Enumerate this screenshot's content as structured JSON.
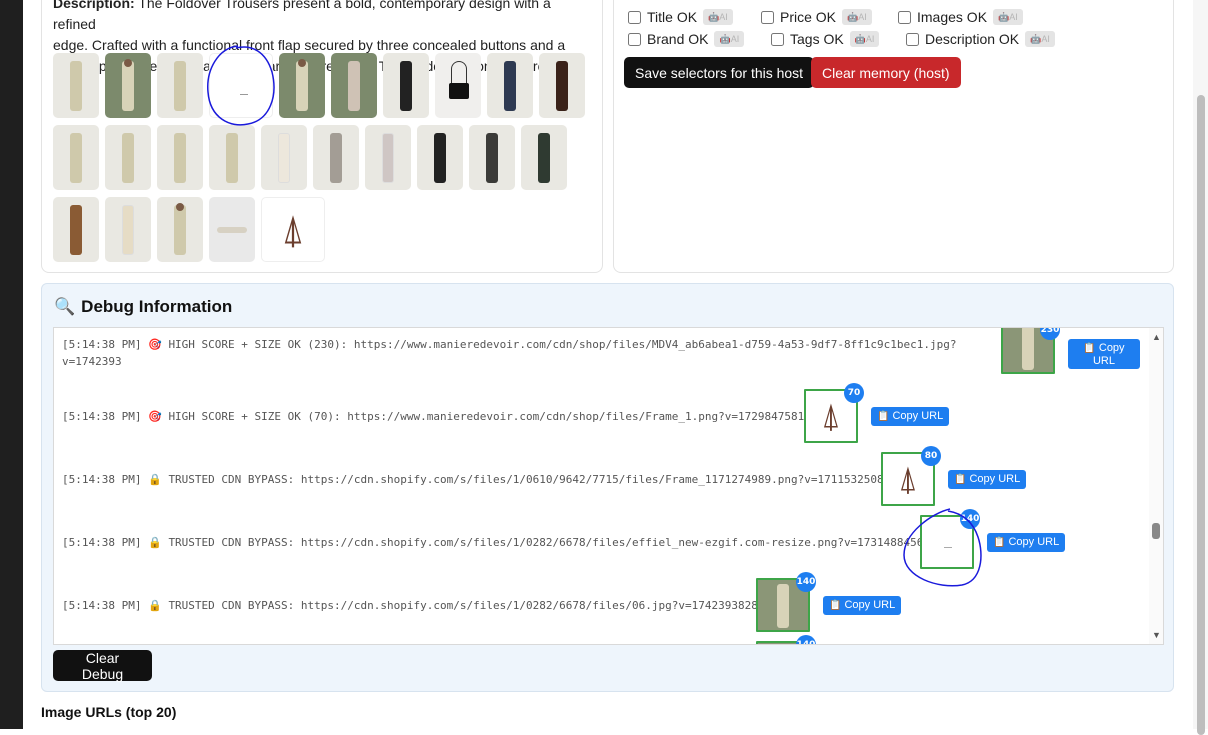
{
  "description": {
    "label": "Description:",
    "line1": "The Foldover Trousers present a bold, contemporary design with a refined",
    "line2": "edge. Crafted with a functional front flap secured by three concealed buttons and a",
    "line3": "central press-crease detail for a sharp, tailored look. The hidden buttons ensure a"
  },
  "checks": [
    {
      "label": "Title OK",
      "ai": "AI"
    },
    {
      "label": "Price OK",
      "ai": "AI"
    },
    {
      "label": "Images OK",
      "ai": "AI"
    },
    {
      "label": "Brand OK",
      "ai": "AI"
    },
    {
      "label": "Tags OK",
      "ai": "AI"
    },
    {
      "label": "Description OK",
      "ai": "AI"
    }
  ],
  "buttons": {
    "save_selectors": "Save selectors for this host",
    "clear_memory": "Clear memory (host)",
    "clear_debug": "Clear Debug"
  },
  "debug": {
    "title": "Debug Information",
    "logs": [
      {
        "time": "[5:14:38 PM]",
        "icon": "🎯",
        "text": "HIGH SCORE + SIZE OK (230): https://www.manieredevoir.com/cdn/shop/files/MDV4_ab6abea1-d759-4a53-9df7-8ff1c9c1bec1.jpg?",
        "text2": "v=1742393",
        "score": "230",
        "copy": "Copy URL"
      },
      {
        "time": "[5:14:38 PM]",
        "icon": "🎯",
        "text": "HIGH SCORE + SIZE OK (70): https://www.manieredevoir.com/cdn/shop/files/Frame_1.png?v=1729847581",
        "score": "70",
        "copy": "Copy URL"
      },
      {
        "time": "[5:14:38 PM]",
        "icon": "🔒",
        "text": "TRUSTED CDN BYPASS: https://cdn.shopify.com/s/files/1/0610/9642/7715/files/Frame_1171274989.png?v=1711532508",
        "score": "80",
        "copy": "Copy URL"
      },
      {
        "time": "[5:14:38 PM]",
        "icon": "🔒",
        "text": "TRUSTED CDN BYPASS: https://cdn.shopify.com/s/files/1/0282/6678/files/effiel_new-ezgif.com-resize.png?v=1731488456",
        "score": "140",
        "copy": "Copy URL"
      },
      {
        "time": "[5:14:38 PM]",
        "icon": "🔒",
        "text": "TRUSTED CDN BYPASS: https://cdn.shopify.com/s/files/1/0282/6678/files/06.jpg?v=1742393828",
        "score": "140",
        "copy": "Copy URL"
      }
    ],
    "partial_score": "140"
  },
  "image_urls_title": "Image URLs (top 20)",
  "icons": {
    "debug": "magnifier-icon",
    "copy": "clipboard-icon",
    "target": "target-icon",
    "lock": "lock-icon",
    "ai": "robot-icon",
    "brand": "eiffel-tower-icon"
  },
  "colors": {
    "accent_blue": "#1e7ef0",
    "danger_red": "#c8282b",
    "dark_button": "#111111",
    "selected_border_green": "#3da548",
    "debug_bg": "#eef5fc",
    "annotation_ink": "#1a1adb"
  }
}
